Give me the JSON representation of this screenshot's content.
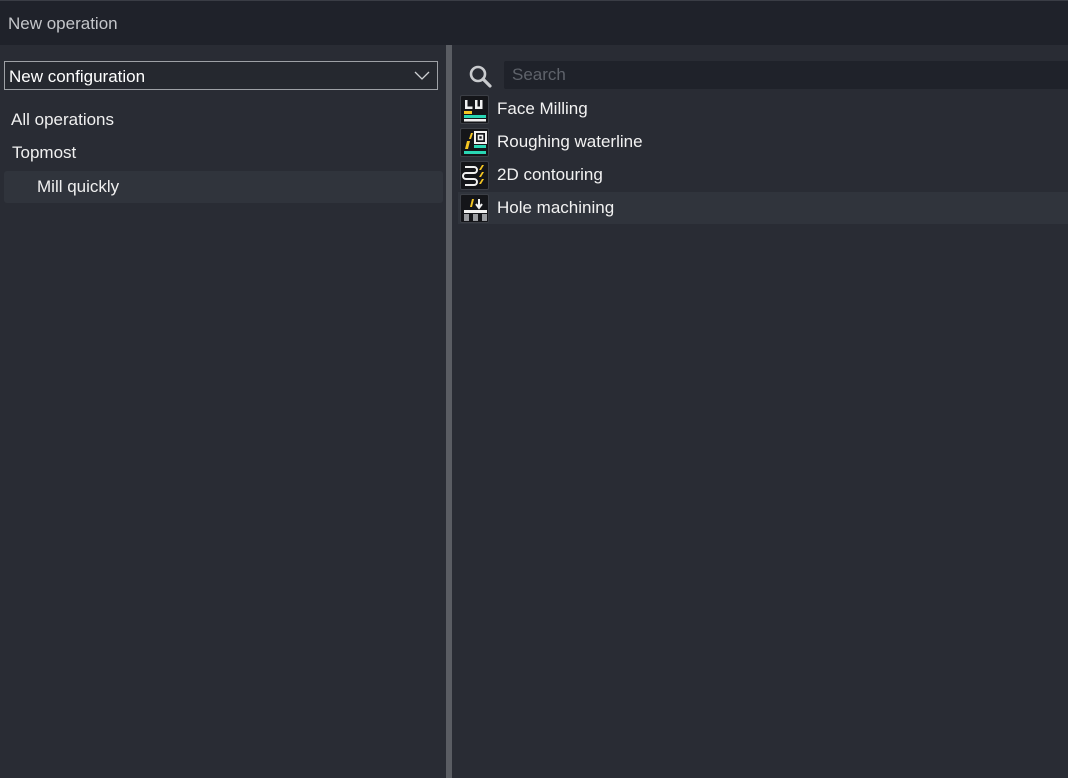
{
  "window": {
    "title": "New operation"
  },
  "configuration": {
    "selected": "New configuration",
    "icon": "chevron-down-icon"
  },
  "tree": {
    "items": [
      {
        "label": "All operations"
      },
      {
        "label": "Topmost"
      },
      {
        "label": "Mill quickly"
      }
    ]
  },
  "search": {
    "placeholder": "Search",
    "value": "",
    "icon": "search-icon"
  },
  "operations": [
    {
      "label": "Face Milling",
      "icon": "face-milling-icon"
    },
    {
      "label": "Roughing waterline",
      "icon": "roughing-waterline-icon"
    },
    {
      "label": "2D contouring",
      "icon": "contouring-2d-icon"
    },
    {
      "label": "Hole machining",
      "icon": "hole-machining-icon"
    }
  ],
  "colors": {
    "accent_yellow": "#f5c623",
    "accent_teal": "#2ad6b4",
    "background": "#292c34",
    "titlebar": "#1f222a"
  }
}
